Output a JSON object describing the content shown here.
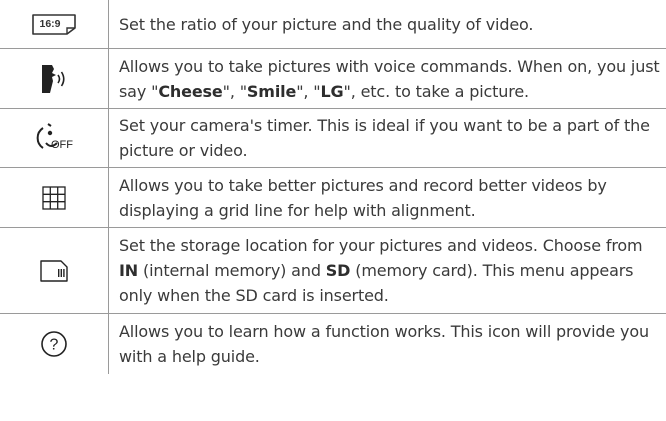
{
  "rows": [
    {
      "icon": "ratio-16-9-icon",
      "icon_text": "16:9",
      "text": "Set the ratio of your picture and the quality of video."
    },
    {
      "icon": "voice-shutter-icon",
      "text_parts": {
        "p1": "Allows you to take pictures with voice commands. When on, you just say \"",
        "b1": "Cheese",
        "p2": "\", \"",
        "b2": "Smile",
        "p3": "\", \"",
        "b3": "LG",
        "p4": "\", etc. to take a picture."
      }
    },
    {
      "icon": "timer-off-icon",
      "icon_text": "OFF",
      "text": "Set your camera's timer. This is ideal if you want to be a part of the picture or video."
    },
    {
      "icon": "grid-icon",
      "text": "Allows you to take better pictures and record better videos by displaying a grid line for help with alignment."
    },
    {
      "icon": "sd-card-storage-icon",
      "text_parts": {
        "p1": "Set the storage location for your pictures and videos. Choose from ",
        "b1": "IN",
        "p2": " (internal memory) and ",
        "b2": "SD",
        "p3": " (memory card). This menu appears only when the SD card is inserted."
      }
    },
    {
      "icon": "help-icon",
      "icon_text": "?",
      "text": "Allows you to learn how a function works. This icon will provide you with a help guide."
    }
  ]
}
